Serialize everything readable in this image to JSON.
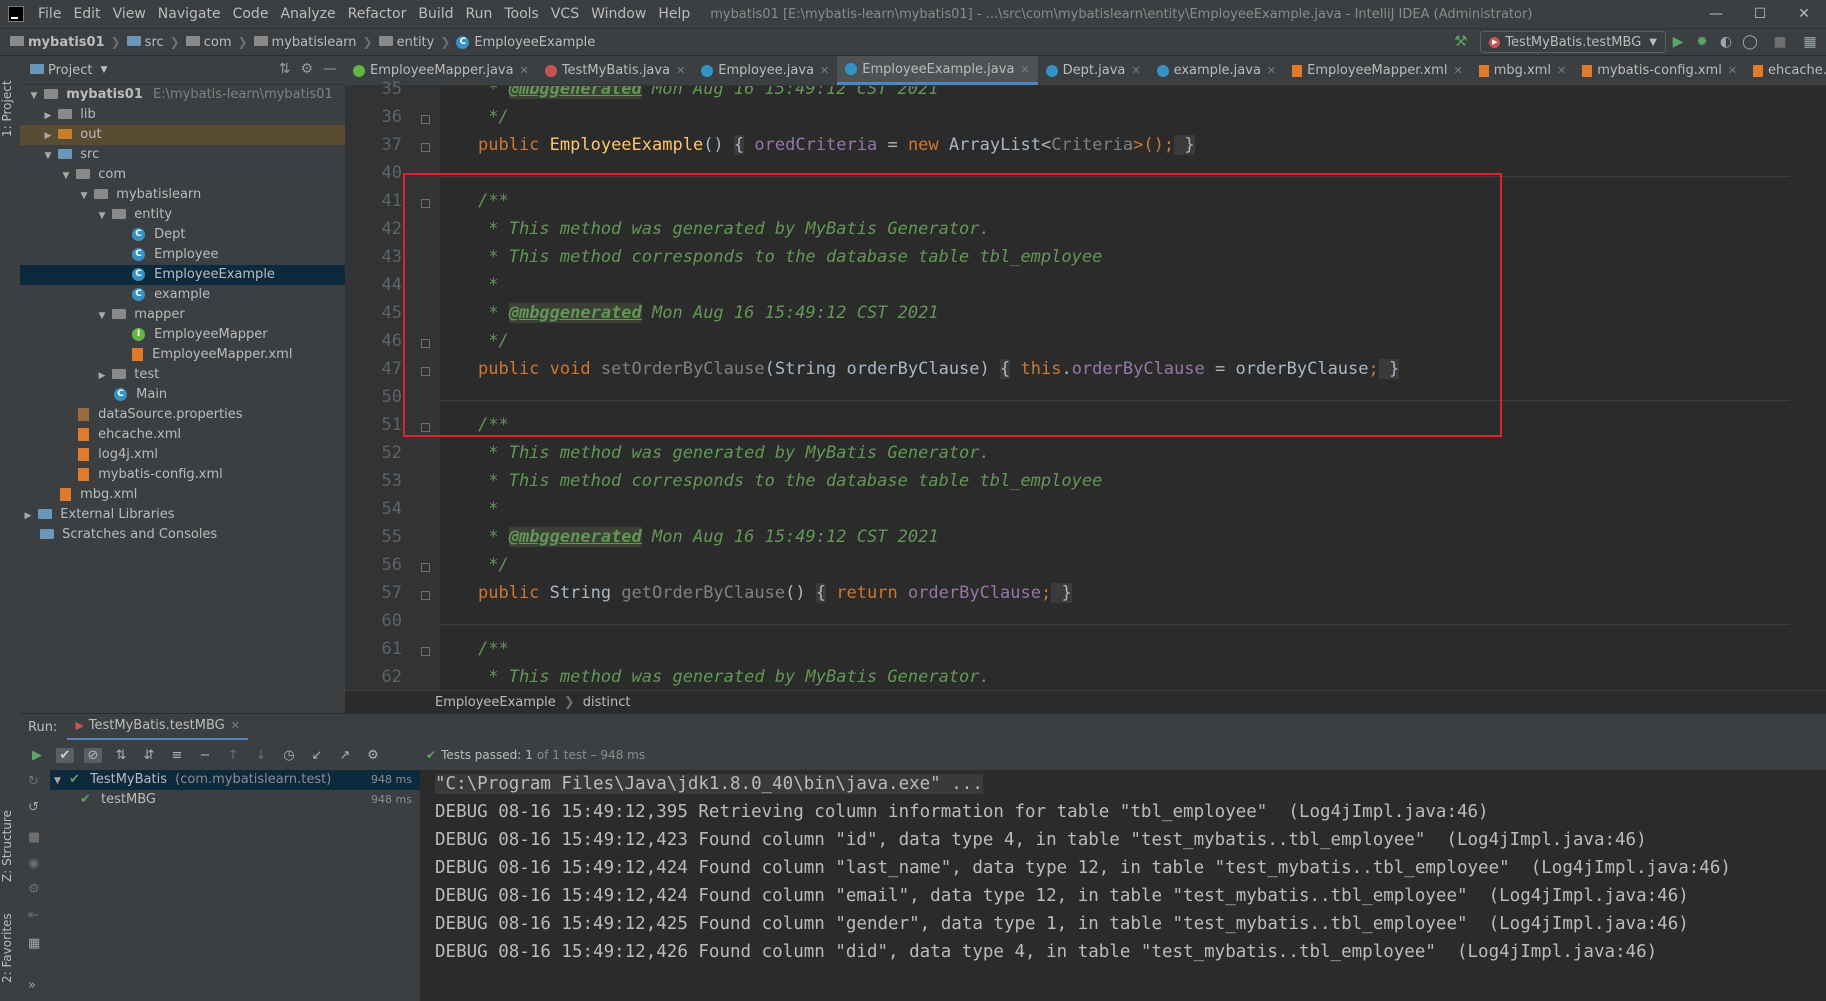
{
  "menubar": {
    "items": [
      "File",
      "Edit",
      "View",
      "Navigate",
      "Code",
      "Analyze",
      "Refactor",
      "Build",
      "Run",
      "Tools",
      "VCS",
      "Window",
      "Help"
    ],
    "title": "mybatis01 [E:\\mybatis-learn\\mybatis01] - ...\\src\\com\\mybatislearn\\entity\\EmployeeExample.java - IntelliJ IDEA (Administrator)"
  },
  "navbar": {
    "crumbs": [
      "mybatis01",
      "src",
      "com",
      "mybatislearn",
      "entity",
      "EmployeeExample"
    ],
    "run_config": "TestMyBatis.testMBG"
  },
  "left_strip": {
    "project_label": "1: Project",
    "structure_label": "Z: Structure",
    "favorites_label": "2: Favorites"
  },
  "project": {
    "header": "Project",
    "tree": [
      {
        "label": "mybatis01",
        "extra": "E:\\mybatis-learn\\mybatis01",
        "bold": true
      },
      {
        "label": "lib"
      },
      {
        "label": "out"
      },
      {
        "label": "src"
      },
      {
        "label": "com"
      },
      {
        "label": "mybatislearn"
      },
      {
        "label": "entity"
      },
      {
        "label": "Dept"
      },
      {
        "label": "Employee"
      },
      {
        "label": "EmployeeExample"
      },
      {
        "label": "example"
      },
      {
        "label": "mapper"
      },
      {
        "label": "EmployeeMapper"
      },
      {
        "label": "EmployeeMapper.xml"
      },
      {
        "label": "test"
      },
      {
        "label": "Main"
      },
      {
        "label": "dataSource.properties"
      },
      {
        "label": "ehcache.xml"
      },
      {
        "label": "log4j.xml"
      },
      {
        "label": "mybatis-config.xml"
      },
      {
        "label": "mbg.xml"
      },
      {
        "label": "External Libraries"
      },
      {
        "label": "Scratches and Consoles"
      }
    ]
  },
  "tabs": [
    {
      "label": "EmployeeMapper.java"
    },
    {
      "label": "TestMyBatis.java"
    },
    {
      "label": "Employee.java"
    },
    {
      "label": "EmployeeExample.java",
      "active": true
    },
    {
      "label": "Dept.java"
    },
    {
      "label": "example.java"
    },
    {
      "label": "EmployeeMapper.xml"
    },
    {
      "label": "mbg.xml"
    },
    {
      "label": "mybatis-config.xml"
    },
    {
      "label": "ehcache.xml"
    }
  ],
  "editor": {
    "line_numbers": [
      "35",
      "36",
      "37",
      "40",
      "41",
      "42",
      "43",
      "44",
      "45",
      "46",
      "47",
      "50",
      "51",
      "52",
      "53",
      "54",
      "55",
      "56",
      "57",
      "60",
      "61",
      "62"
    ],
    "code": {
      "l35_star": " * ",
      "l35_tag": "@mbggenerated",
      "l35_rest": " Mon Aug 16 15:49:12 CST 2021",
      "l36": " */",
      "l37_kw": "public ",
      "l37_fn": "EmployeeExample",
      "l37_p": "() ",
      "l37_b1": "{",
      "l37_f": " oredCriteria",
      "l37_eq": " = ",
      "l37_new": "new ",
      "l37_t": "ArrayList<",
      "l37_g": "Criteria",
      "l37_end": ">();",
      "l37_b2": " }",
      "l41": "/**",
      "l42": " * This method was generated by MyBatis Generator.",
      "l43": " * This method corresponds to the database table tbl_employee",
      "l44": " *",
      "l45_star": " * ",
      "l45_tag": "@mbggenerated",
      "l45_rest": " Mon Aug 16 15:49:12 CST 2021",
      "l46": " */",
      "l47_kw": "public void ",
      "l47_fn": "setOrderByClause",
      "l47_p": "(String orderByClause) ",
      "l47_b1": "{",
      "l47_this": " this",
      "l47_dot": ".",
      "l47_f": "orderByClause",
      "l47_eq": " = orderByClause",
      "l47_semi": ";",
      "l47_b2": " }",
      "l51": "/**",
      "l52": " * This method was generated by MyBatis Generator.",
      "l53": " * This method corresponds to the database table tbl_employee",
      "l54": " *",
      "l55_star": " * ",
      "l55_tag": "@mbggenerated",
      "l55_rest": " Mon Aug 16 15:49:12 CST 2021",
      "l56": " */",
      "l57_kw": "public ",
      "l57_t": "String ",
      "l57_fn": "getOrderByClause",
      "l57_p": "() ",
      "l57_b1": "{",
      "l57_ret": " return ",
      "l57_f": "orderByClause",
      "l57_semi": ";",
      "l57_b2": " }",
      "l61": "/**",
      "l62": " * This method was generated by MyBatis Generator."
    },
    "breadcrumb": [
      "EmployeeExample",
      "distinct"
    ]
  },
  "run": {
    "label": "Run:",
    "tab": "TestMyBatis.testMBG",
    "status_ok": "Tests passed:",
    "status_count": "1",
    "status_rest": "of 1 test – 948 ms",
    "tests": [
      {
        "name": "TestMyBatis",
        "pkg": "(com.mybatislearn.test)",
        "time": "948 ms"
      },
      {
        "name": "testMBG",
        "time": "948 ms"
      }
    ],
    "console": [
      "\"C:\\Program Files\\Java\\jdk1.8.0_40\\bin\\java.exe\" ...",
      "DEBUG 08-16 15:49:12,395 Retrieving column information for table \"tbl_employee\"  (Log4jImpl.java:46)",
      "DEBUG 08-16 15:49:12,423 Found column \"id\", data type 4, in table \"test_mybatis..tbl_employee\"  (Log4jImpl.java:46)",
      "DEBUG 08-16 15:49:12,424 Found column \"last_name\", data type 12, in table \"test_mybatis..tbl_employee\"  (Log4jImpl.java:46)",
      "DEBUG 08-16 15:49:12,424 Found column \"email\", data type 12, in table \"test_mybatis..tbl_employee\"  (Log4jImpl.java:46)",
      "DEBUG 08-16 15:49:12,425 Found column \"gender\", data type 1, in table \"test_mybatis..tbl_employee\"  (Log4jImpl.java:46)",
      "DEBUG 08-16 15:49:12,426 Found column \"did\", data type 4, in table \"test_mybatis..tbl_employee\"  (Log4jImpl.java:46)"
    ]
  },
  "colors": {
    "highlight_box": "#e0232a",
    "accent": "#4a88c7",
    "comment": "#629755",
    "keyword": "#cc7832"
  }
}
